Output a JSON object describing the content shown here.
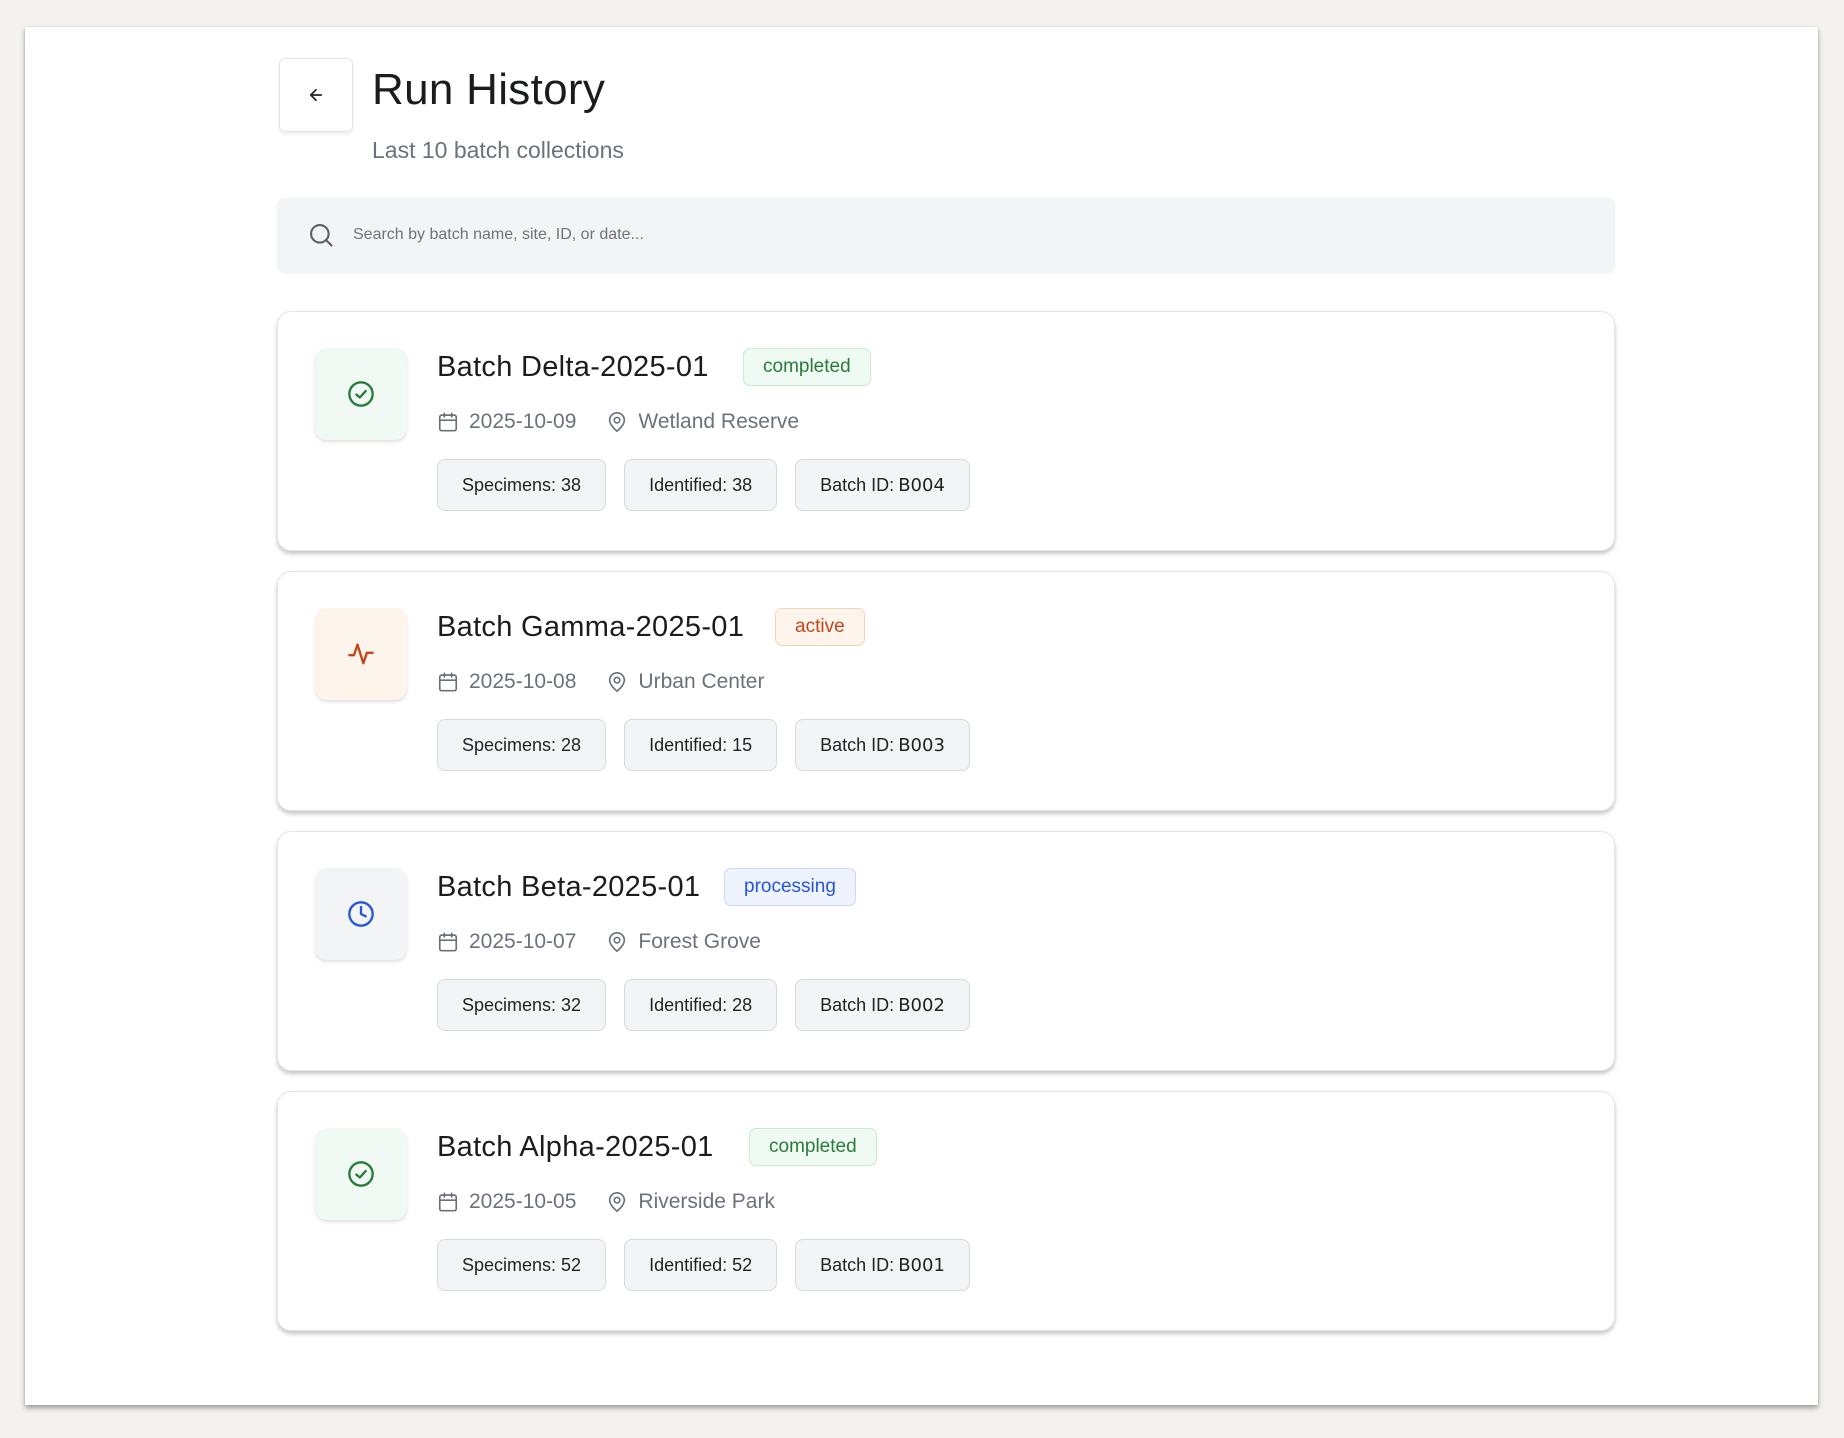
{
  "header": {
    "title": "Run History",
    "subtitle": "Last 10 batch collections"
  },
  "search": {
    "placeholder": "Search by batch name, site, ID, or date..."
  },
  "colors": {
    "completed": "#2c7a3c",
    "active": "#c4451a",
    "processing": "#2557d6"
  },
  "batches": [
    {
      "name": "Batch Delta-2025-01",
      "status": "completed",
      "status_icon": "check-circle-icon",
      "date": "2025-10-09",
      "site": "Wetland Reserve",
      "specimens": "Specimens: 38",
      "identified": "Identified: 38",
      "id_label": "Batch ID:",
      "id_value": "B004"
    },
    {
      "name": "Batch Gamma-2025-01",
      "status": "active",
      "status_icon": "activity-icon",
      "date": "2025-10-08",
      "site": "Urban Center",
      "specimens": "Specimens: 28",
      "identified": "Identified: 15",
      "id_label": "Batch ID:",
      "id_value": "B003"
    },
    {
      "name": "Batch Beta-2025-01",
      "status": "processing",
      "status_icon": "clock-icon",
      "date": "2025-10-07",
      "site": "Forest Grove",
      "specimens": "Specimens: 32",
      "identified": "Identified: 28",
      "id_label": "Batch ID:",
      "id_value": "B002"
    },
    {
      "name": "Batch Alpha-2025-01",
      "status": "completed",
      "status_icon": "check-circle-icon",
      "date": "2025-10-05",
      "site": "Riverside Park",
      "specimens": "Specimens: 52",
      "identified": "Identified: 52",
      "id_label": "Batch ID:",
      "id_value": "B001"
    }
  ]
}
